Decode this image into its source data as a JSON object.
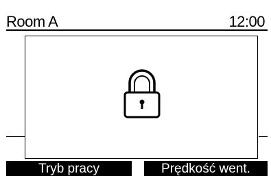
{
  "header": {
    "title": "Room A",
    "time": "12:00"
  },
  "dialog": {
    "icon": "lock-icon"
  },
  "softkeys": [
    {
      "label": "Tryb pracy"
    },
    {
      "label": "Prędkość went."
    }
  ]
}
